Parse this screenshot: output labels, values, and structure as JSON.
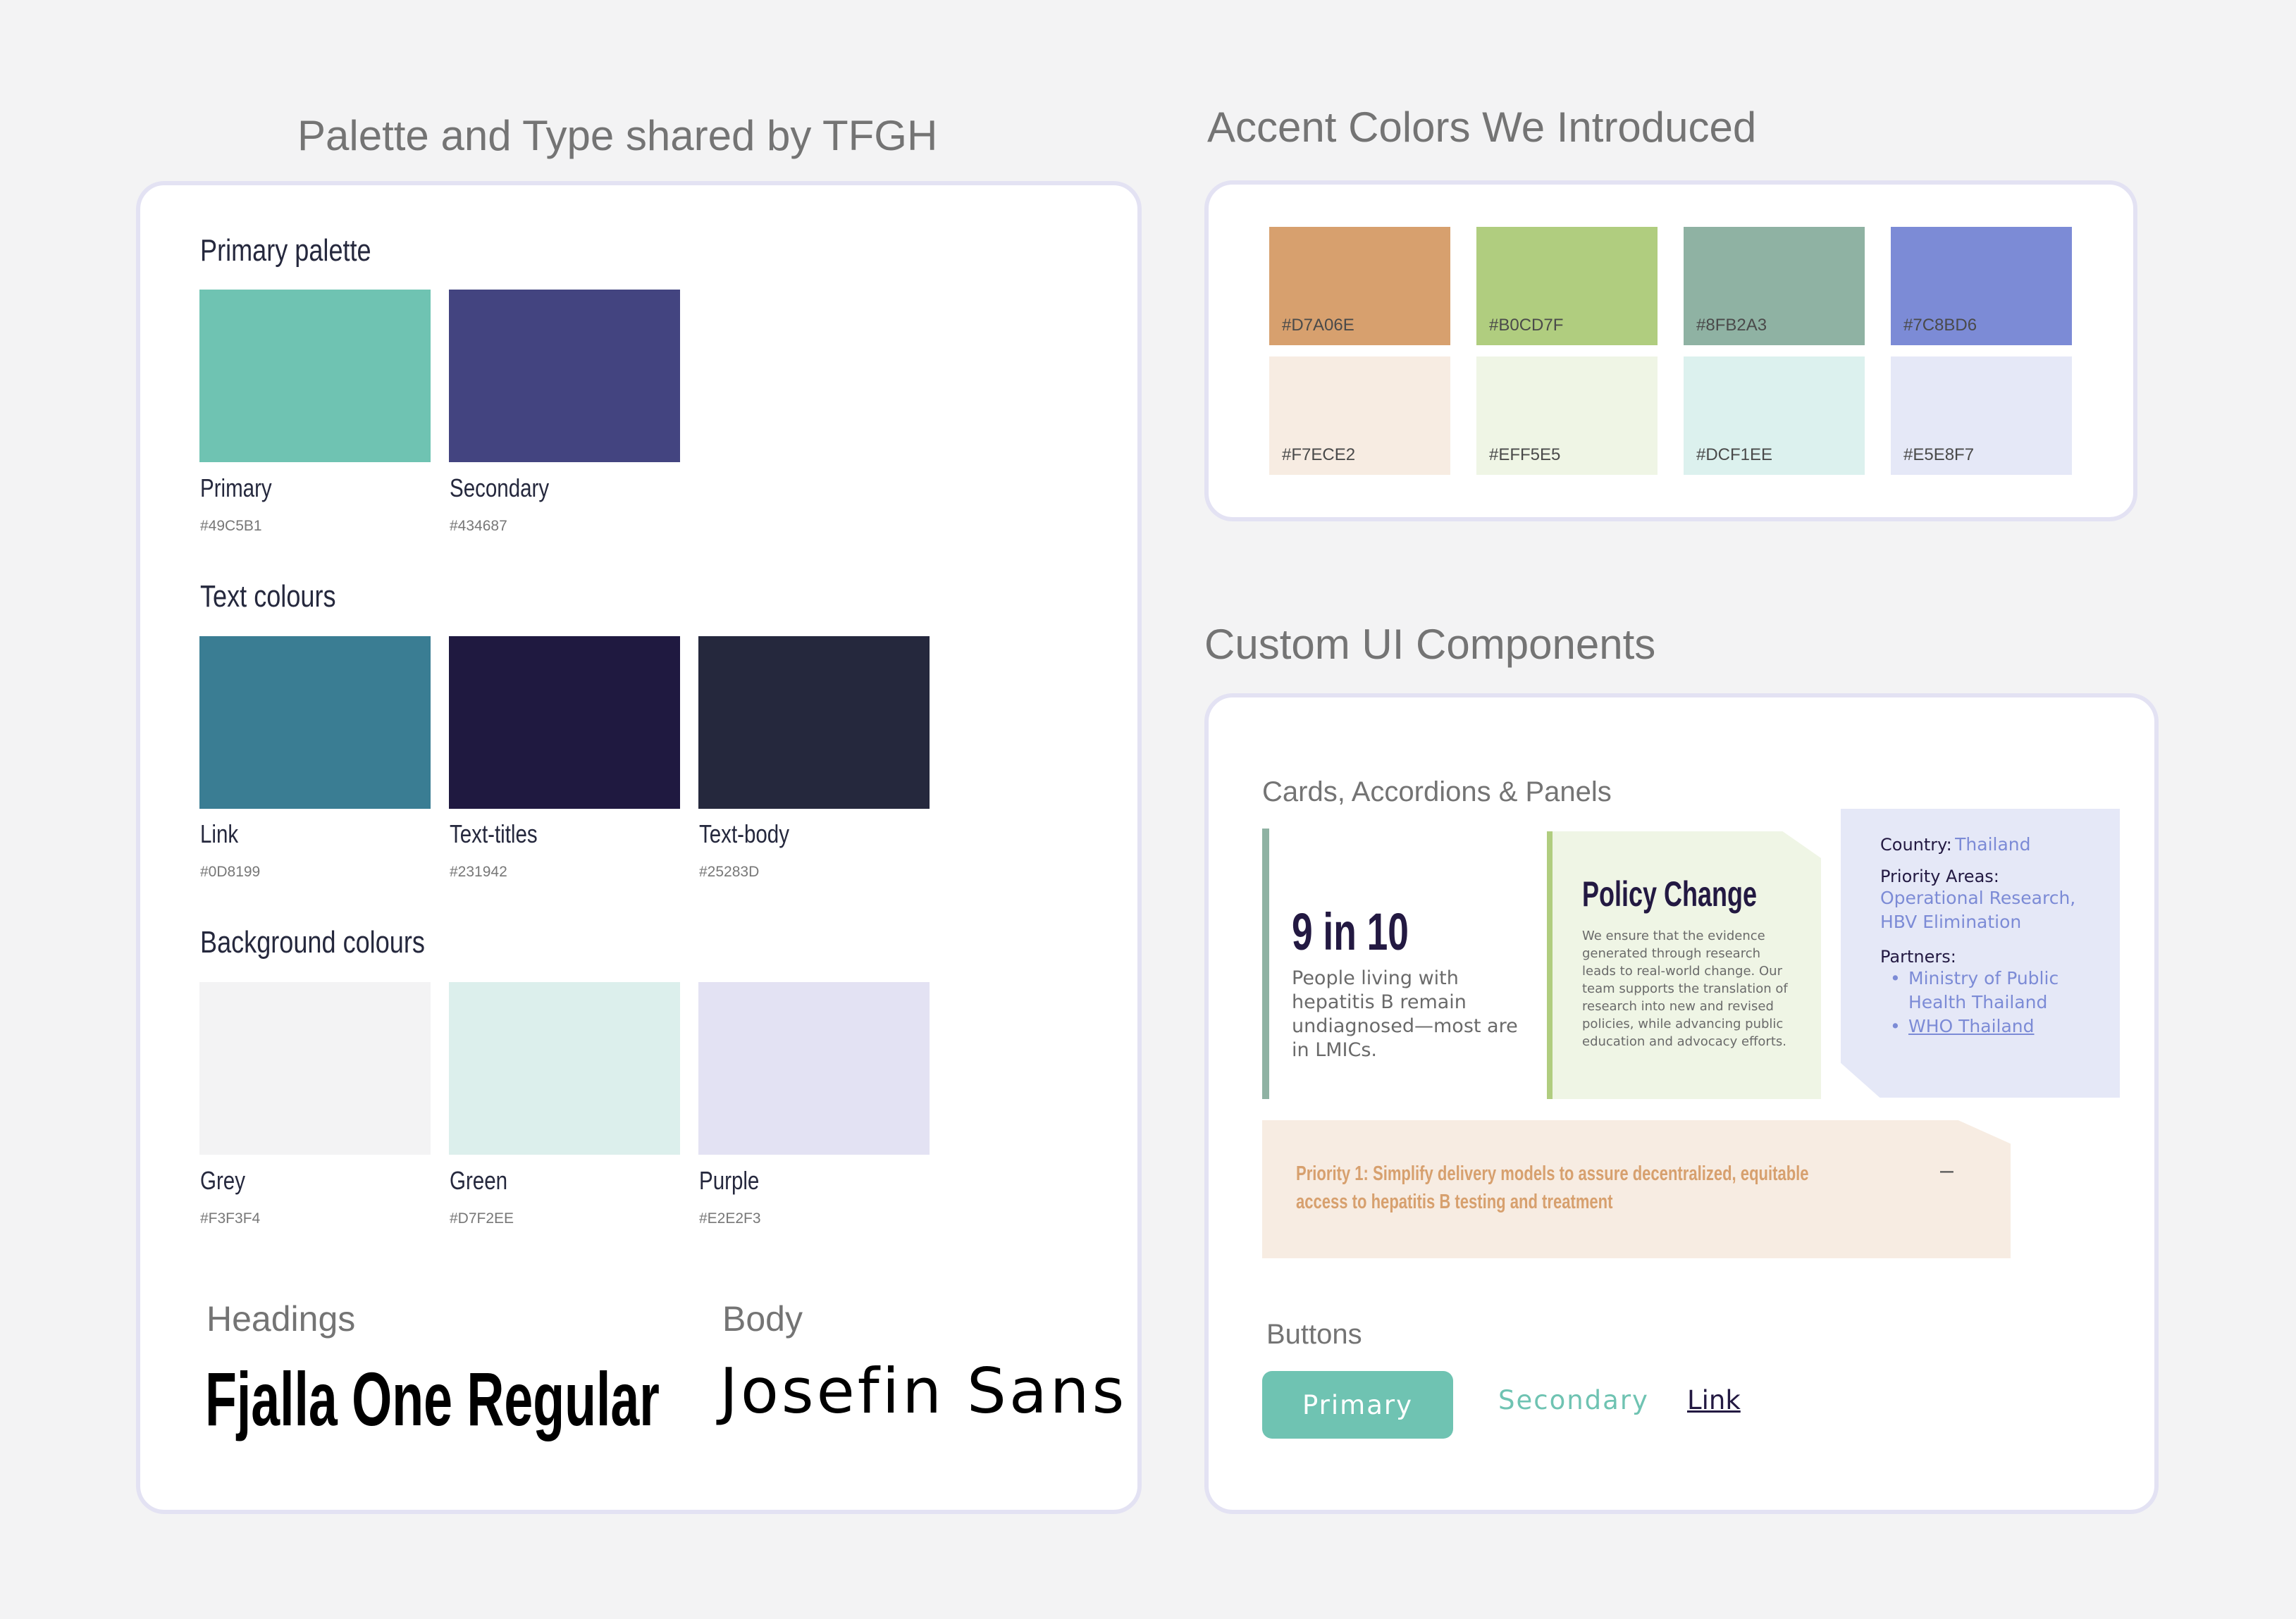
{
  "left_section": {
    "title": "Palette and Type shared by TFGH",
    "primary_palette": {
      "heading": "Primary palette",
      "swatches": [
        {
          "name": "Primary",
          "hex": "#49C5B1",
          "color": "#6fc3b2"
        },
        {
          "name": "Secondary",
          "hex": "#434687",
          "color": "#434480"
        }
      ]
    },
    "text_colours": {
      "heading": "Text colours",
      "swatches": [
        {
          "name": "Link",
          "hex": "#0D8199",
          "color": "#3a7d93"
        },
        {
          "name": "Text-titles",
          "hex": "#231942",
          "color": "#1f1940"
        },
        {
          "name": "Text-body",
          "hex": "#25283D",
          "color": "#25283d"
        }
      ]
    },
    "background_colours": {
      "heading": "Background colours",
      "swatches": [
        {
          "name": "Grey",
          "hex": "#F3F3F4",
          "color": "#f3f3f4"
        },
        {
          "name": "Green",
          "hex": "#D7F2EE",
          "color": "#dcefec"
        },
        {
          "name": "Purple",
          "hex": "#E2E2F3",
          "color": "#e3e2f3"
        }
      ]
    },
    "typography": {
      "headings_label": "Headings",
      "headings_font": "Fjalla One Regular",
      "body_label": "Body",
      "body_font": "Josefin Sans"
    }
  },
  "accent_section": {
    "title": "Accent Colors We Introduced",
    "swatches": [
      {
        "hex": "#D7A06E",
        "color": "#d7a06e"
      },
      {
        "hex": "#B0CD7F",
        "color": "#b0cd7f"
      },
      {
        "hex": "#8FB2A3",
        "color": "#8fb2a3"
      },
      {
        "hex": "#7C8BD6",
        "color": "#7c8bd6"
      },
      {
        "hex": "#F7ECE2",
        "color": "#f7ece2"
      },
      {
        "hex": "#EFF5E5",
        "color": "#eff5e5"
      },
      {
        "hex": "#DCF1EE",
        "color": "#dcf1ee"
      },
      {
        "hex": "#E5E8F7",
        "color": "#e5e8f7"
      }
    ]
  },
  "components_section": {
    "title": "Custom UI Components",
    "cards_label": "Cards, Accordions & Panels",
    "stat_card": {
      "stat": "9 in 10",
      "text": "People living with hepatitis B remain undiagnosed—most are in LMICs."
    },
    "policy_card": {
      "heading": "Policy Change",
      "text": "We ensure that the evidence generated through research leads to real-world change. Our team supports the translation of research into new and revised policies, while advancing public education and advocacy efforts."
    },
    "info_panel": {
      "country_label": "Country:",
      "country_value": "Thailand",
      "areas_label": "Priority Areas:",
      "areas_value": "Operational Research, HBV Elimination",
      "partners_label": "Partners:",
      "partners": [
        "Ministry of Public Health Thailand",
        "WHO Thailand"
      ]
    },
    "accordion": {
      "text": "Priority 1: Simplify delivery models to assure decentralized, equitable access to hepatitis B testing and treatment",
      "toggle": "–"
    },
    "buttons_label": "Buttons",
    "buttons": {
      "primary": "Primary",
      "secondary": "Secondary",
      "link": "Link"
    }
  }
}
